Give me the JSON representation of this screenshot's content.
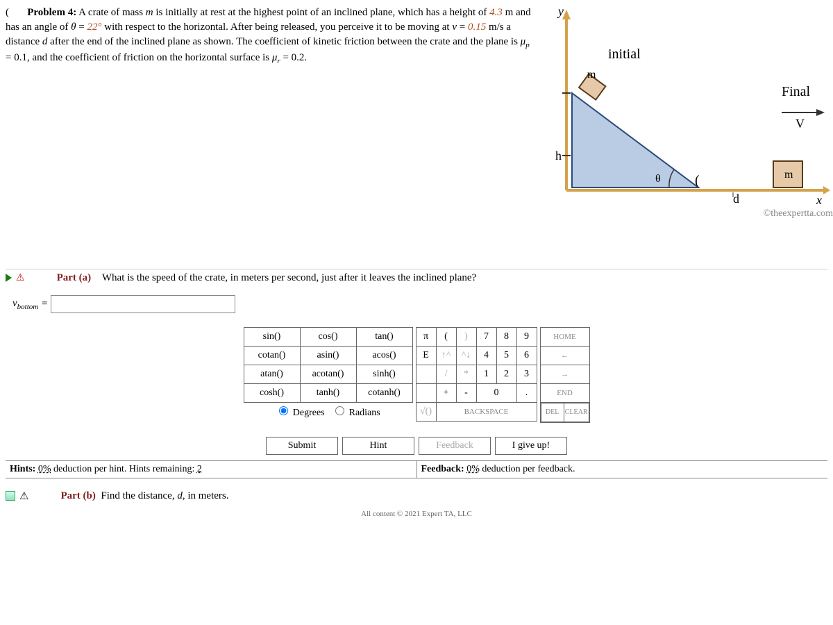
{
  "problem": {
    "title": "Problem 4:",
    "body_html": "A crate of mass <i>m</i> is initially at rest at the highest point of an inclined plane, which has a height of <span class='num'>4.3</span> m and has an angle of <i>θ</i> = <span class='num'>22°</span> with respect to the horizontal. After being released, you perceive it to be moving at <i>v</i> = <span class='num'>0.15</span> m/s a distance <i>d</i> after the end of the inclined plane as shown. The coefficient of kinetic friction between the crate and the plane is <i>μ<sub>p</sub></i> = 0.1, and the coefficient of friction on the horizontal surface is <i>μ<sub>r</sub></i> = 0.2."
  },
  "diagram": {
    "y_label": "y",
    "x_label": "x",
    "initial_label": "initial",
    "h_label": "h",
    "m_label": "m",
    "theta_label": "θ",
    "final_label": "Final",
    "v_label": "V",
    "block_label": "m",
    "d_label": "d"
  },
  "copyright": "©theexpertta.com",
  "part_a": {
    "label": "Part (a)",
    "question": "What is the speed of the crate, in meters per second, just after it leaves the inclined plane?",
    "var_html": "<i>v</i><sub>bottom</sub>",
    "equals": " = "
  },
  "keypad": {
    "funcs": [
      [
        "sin()",
        "cos()",
        "tan()"
      ],
      [
        "cotan()",
        "asin()",
        "acos()"
      ],
      [
        "atan()",
        "acotan()",
        "sinh()"
      ],
      [
        "cosh()",
        "tanh()",
        "cotanh()"
      ]
    ],
    "mode_degrees": "Degrees",
    "mode_radians": "Radians",
    "nums": [
      [
        "π",
        "(",
        ")",
        "7",
        "8",
        "9"
      ],
      [
        "E",
        "↑^",
        "^↓",
        "4",
        "5",
        "6"
      ],
      [
        "",
        "/",
        "*",
        "1",
        "2",
        "3"
      ],
      [
        "",
        "+",
        "-",
        "0",
        "",
        "."
      ]
    ],
    "sqrt": "√()",
    "backspace": "BACKSPACE",
    "nav": [
      "HOME",
      "←",
      "→",
      "END"
    ],
    "del": "DEL",
    "clear": "CLEAR"
  },
  "actions": {
    "submit": "Submit",
    "hint": "Hint",
    "feedback": "Feedback",
    "giveup": "I give up!"
  },
  "hints": {
    "hints_label": "Hints:",
    "hints_pct": "0%",
    "hints_tail": "deduction per hint. Hints remaining:",
    "hints_remaining": "2",
    "feedback_label": "Feedback:",
    "feedback_pct": "0%",
    "feedback_tail": "deduction per feedback."
  },
  "part_b": {
    "label": "Part (b)",
    "text": "Find the distance, ",
    "var": "d",
    "tail": ", in meters."
  },
  "footer": "All content © 2021 Expert TA, LLC"
}
